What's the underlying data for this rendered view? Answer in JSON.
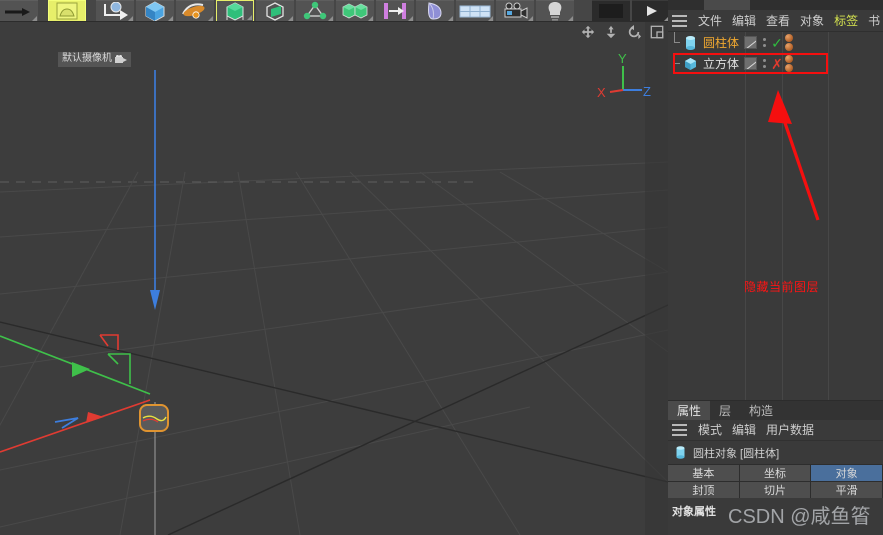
{
  "toolbar": {
    "buttons": [
      {
        "name": "undo-redo-tool",
        "icon": "arrow-right-icon",
        "state": "normal"
      },
      {
        "name": "live-selection-tool",
        "icon": "selection-blob-icon",
        "state": "selected"
      },
      {
        "name": "move-tool",
        "icon": "move-arrow-icon",
        "state": "normal"
      },
      {
        "name": "scale-tool",
        "icon": "cube-blue-icon",
        "state": "normal"
      },
      {
        "name": "rotate-tool",
        "icon": "rotate-band-icon",
        "state": "normal"
      },
      {
        "name": "cube-primitive-tool",
        "icon": "green-cube-icon",
        "state": "outlined"
      },
      {
        "name": "spline-tool",
        "icon": "open-cube-icon",
        "state": "normal"
      },
      {
        "name": "array-tool",
        "icon": "node-graph-icon",
        "state": "normal"
      },
      {
        "name": "mograph-tool",
        "icon": "two-cubes-icon",
        "state": "normal"
      },
      {
        "name": "symmetry-tool",
        "icon": "mirror-bars-icon",
        "state": "normal"
      },
      {
        "name": "deformer-tool",
        "icon": "bend-shape-icon",
        "state": "normal"
      },
      {
        "name": "floor-tool",
        "icon": "grid-plane-icon",
        "state": "normal"
      },
      {
        "name": "camera-tool",
        "icon": "video-camera-icon",
        "state": "normal"
      },
      {
        "name": "light-tool",
        "icon": "light-bulb-icon",
        "state": "normal"
      },
      {
        "name": "render-view-button",
        "icon": "render-frame-icon",
        "state": "dark"
      },
      {
        "name": "render-to-picture-viewer-button",
        "icon": "play-triangle-icon",
        "state": "dark"
      },
      {
        "name": "render-settings-button",
        "icon": "gear-icon",
        "state": "selected"
      }
    ]
  },
  "viewport": {
    "camera_label": "默认摄像机",
    "camera_icon": "camera-icon",
    "nav_icons": [
      "move-view-icon",
      "pan-view-icon",
      "rotate-view-icon",
      "maximize-view-icon"
    ],
    "axis_gizmo": {
      "x_label": "X",
      "x_color": "#e03b32",
      "y_label": "Y",
      "y_color": "#3fc04a",
      "z_label": "Z",
      "z_color": "#3d7ede"
    },
    "background_color": "#3d3d3d",
    "grid_color": "#4f4f4f"
  },
  "object_manager": {
    "menu": {
      "hamburger": "hamburger-icon",
      "items": [
        {
          "label": "文件",
          "highlighted": false
        },
        {
          "label": "编辑",
          "highlighted": false
        },
        {
          "label": "查看",
          "highlighted": false
        },
        {
          "label": "对象",
          "highlighted": false
        },
        {
          "label": "标签",
          "highlighted": true
        },
        {
          "label": "书",
          "highlighted": false
        }
      ]
    },
    "rows": [
      {
        "name": "圆柱体",
        "icon": "cylinder-icon",
        "name_color": "#f0a830",
        "selected": false,
        "visibility_mark": "✓",
        "visibility_state": "visible",
        "tags": 2
      },
      {
        "name": "立方体",
        "icon": "cube-icon",
        "name_color": "#e0e0e0",
        "selected": true,
        "visibility_mark": "✗",
        "visibility_state": "hidden",
        "tags": 2
      }
    ],
    "annotation": {
      "text": "隐藏当前图层",
      "color": "#fd1414",
      "highlight_box_color": "#f50f0f",
      "arrow": "red-arrow-pointing-to-hidden-toggle"
    }
  },
  "attributes": {
    "tabs": [
      {
        "label": "属性",
        "active": true
      },
      {
        "label": "层",
        "active": false
      },
      {
        "label": "构造",
        "active": false
      }
    ],
    "menu": {
      "hamburger": "hamburger-icon",
      "items": [
        "模式",
        "编辑",
        "用户数据"
      ]
    },
    "object_title": "圆柱对象 [圆柱体]",
    "object_icon": "cylinder-icon",
    "button_rows": [
      [
        {
          "label": "基本",
          "highlighted": false
        },
        {
          "label": "坐标",
          "highlighted": false
        },
        {
          "label": "对象",
          "highlighted": true
        }
      ],
      [
        {
          "label": "封顶",
          "highlighted": false
        },
        {
          "label": "切片",
          "highlighted": false
        },
        {
          "label": "平滑",
          "highlighted": false
        }
      ]
    ],
    "section_title": "对象属性"
  },
  "watermark": "CSDN @咸鱼箵"
}
